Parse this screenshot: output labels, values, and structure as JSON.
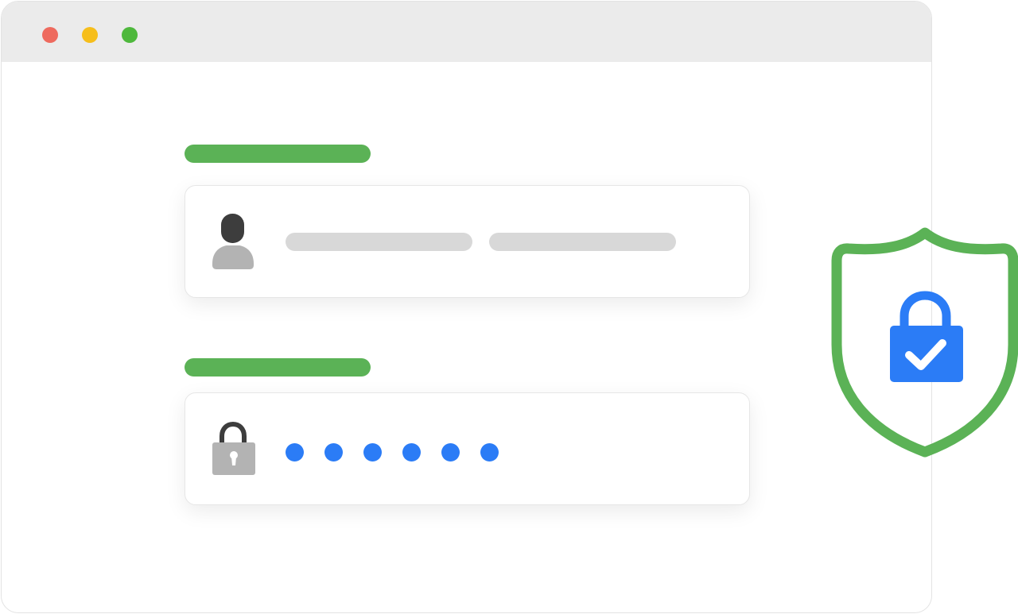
{
  "window": {
    "traffic_lights": [
      {
        "name": "close",
        "color": "#ee6a5e"
      },
      {
        "name": "minimize",
        "color": "#f6be1b"
      },
      {
        "name": "maximize",
        "color": "#4eb83c"
      }
    ]
  },
  "colors": {
    "accent_green": "#5bb256",
    "accent_blue": "#2b7cf6",
    "icon_gray": "#b3b3b3",
    "icon_dark": "#3d3d3d",
    "placeholder_gray": "#d8d8d8"
  },
  "login_form": {
    "username_field": {
      "icon": "user-icon",
      "value_placeholder_bars": 2
    },
    "password_field": {
      "icon": "padlock-icon",
      "masked_value": "●●●●●●",
      "masked_char_count": 6
    }
  },
  "security_badge": {
    "icon": "shield-unlock-check-icon"
  }
}
